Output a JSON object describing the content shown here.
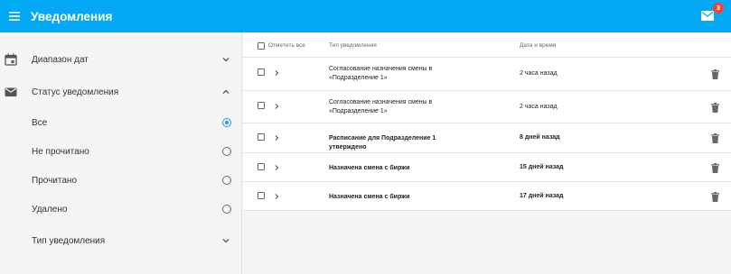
{
  "appbar": {
    "title": "Уведомления",
    "menu_icon": "menu-icon",
    "mail_icon": "mail-icon",
    "badge_count": "3",
    "color": "#03a9f4"
  },
  "sidebar": {
    "date_range": "Диапазон дат",
    "status_section": "Статус уведомления",
    "status_options": [
      "Все",
      "Не прочитано",
      "Прочитано",
      "Удалено"
    ],
    "selected_status": "Все",
    "type_section": "Тип уведомления"
  },
  "table": {
    "headers": {
      "select_all": "Отметить все",
      "type": "Тип уведомления",
      "date": "Дата и время"
    },
    "rows": [
      {
        "type": "Согласование назначения смены в «Подразделение 1»",
        "date": "2 часа назад",
        "bold": false
      },
      {
        "type": "Согласование назначения смены в «Подразделение 1»",
        "date": "2 часа назад",
        "bold": false
      },
      {
        "type": "Расписание для Подразделение 1 утверждено",
        "date": "8 дней назад",
        "bold": true
      },
      {
        "type": "Назначена смена с биржи",
        "date": "15 дней назад",
        "bold": true
      },
      {
        "type": "Назначена смена с биржи",
        "date": "17 дней назад",
        "bold": true
      }
    ]
  }
}
